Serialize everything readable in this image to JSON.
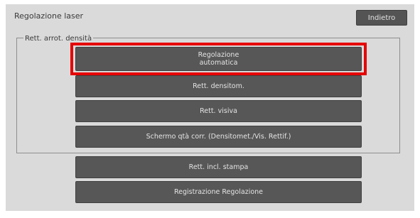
{
  "header": {
    "title": "Regolazione laser",
    "back_label": "Indietro"
  },
  "density_group": {
    "label": "Rett. arrot. densità",
    "auto_adjust": {
      "line1": "Regolazione",
      "line2": "automatica"
    },
    "densitometer_label": "Rett. densitom.",
    "visual_label": "Rett. visiva",
    "correction_screen_label": "Schermo qtà corr. (Densitomet./Vis. Rettif.)"
  },
  "print_tilt_label": "Rett. incl. stampa",
  "registration_label": "Registrazione Regolazione",
  "colors": {
    "highlight": "#e60000",
    "button_bg": "#575757",
    "panel_bg": "#dadada"
  }
}
